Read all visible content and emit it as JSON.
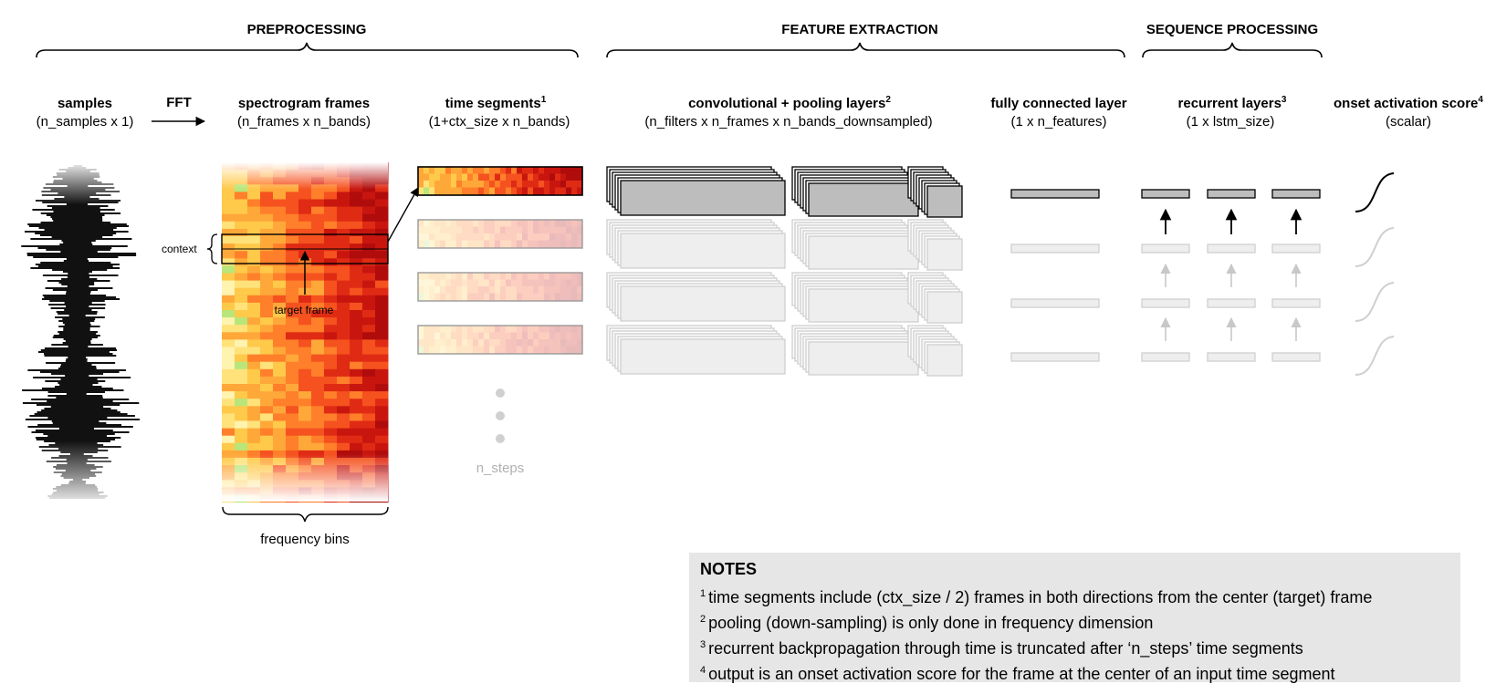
{
  "sections": {
    "preprocessing": "PREPROCESSING",
    "feature_extraction": "FEATURE EXTRACTION",
    "sequence_processing": "SEQUENCE PROCESSING"
  },
  "columns": {
    "samples": {
      "title": "samples",
      "dim": "(n_samples x 1)"
    },
    "fft": "FFT",
    "spectrogram": {
      "title": "spectrogram frames",
      "dim": "(n_frames x n_bands)"
    },
    "time_segments": {
      "title": "time segments",
      "sup": "1",
      "dim": "(1+ctx_size x n_bands)"
    },
    "conv": {
      "title": "convolutional + pooling layers",
      "sup": "2",
      "dim": "(n_filters x n_frames x n_bands_downsampled)"
    },
    "fc": {
      "title": "fully connected layer",
      "dim": "(1 x n_features)"
    },
    "recurrent": {
      "title": "recurrent layers",
      "sup": "3",
      "dim": "(1 x lstm_size)"
    },
    "onset": {
      "title": "onset activation score",
      "sup": "4",
      "dim": "(scalar)"
    }
  },
  "labels": {
    "context": "context",
    "target_frame": "target frame",
    "frequency_bins": "frequency bins",
    "n_steps": "n_steps"
  },
  "notes": {
    "title": "NOTES",
    "items": [
      {
        "num": "1",
        "text": "time segments include (ctx_size / 2) frames in both directions from the center (target) frame"
      },
      {
        "num": "2",
        "text": "pooling (down-sampling) is only done in frequency dimension"
      },
      {
        "num": "3",
        "text": "recurrent backpropagation through time is truncated after ‘n_steps’ time segments"
      },
      {
        "num": "4",
        "text": "output is an onset activation score for the frame at the center of an input time segment"
      }
    ]
  },
  "colors": {
    "dark_box": "#bdbdbd",
    "faded_box": "#eeeeee",
    "faded_stroke": "#cfcfcf",
    "notes_bg": "#e6e6e6"
  }
}
